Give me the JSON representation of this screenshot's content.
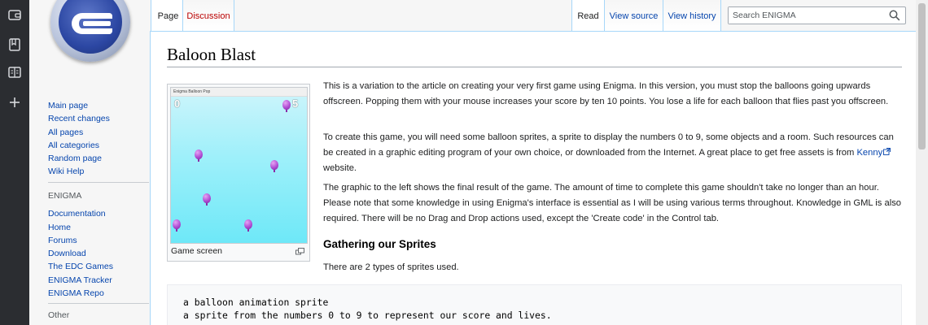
{
  "rail": {
    "icons": [
      "wallet-icon",
      "bookmark-icon",
      "reader-icon",
      "plus-icon"
    ]
  },
  "logo": {
    "name": "enigma-logo-icon"
  },
  "sidebar": {
    "navigation": [
      "Main page",
      "Recent changes",
      "All pages",
      "All categories",
      "Random page",
      "Wiki Help"
    ],
    "enigma_heading": "ENIGMA",
    "enigma_links": [
      "Documentation",
      "Home",
      "Forums",
      "Download",
      "The EDC Games",
      "ENIGMA Tracker",
      "ENIGMA Repo"
    ],
    "other_heading": "Other"
  },
  "tabs": {
    "page": "Page",
    "discussion": "Discussion",
    "read": "Read",
    "view_source": "View source",
    "view_history": "View history"
  },
  "search": {
    "placeholder": "Search ENIGMA",
    "icon": "search-icon"
  },
  "article": {
    "title": "Baloon Blast",
    "thumbnail": {
      "window_title": "Enigma Balloon Pop",
      "score": "0",
      "lives": "5",
      "caption": "Game screen",
      "enlarge_icon": "enlarge-icon"
    },
    "para1": "This is a variation to the article on creating your very first game using Enigma. In this version, you must stop the balloons going upwards offscreen. Popping them with your mouse increases your score by ten 10 points. You lose a life for each balloon that flies past you offscreen.",
    "para2_before": "To create this game, you will need some balloon sprites, a sprite to display the numbers 0 to 9, some objects and a room. Such resources can be created in a graphic editing program of your own choice, or downloaded from the Internet. A great place to get free assets is from ",
    "para2_link": "Kenny",
    "para2_after": " website.",
    "para3": "The graphic to the left shows the final result of the game. The amount of time to complete this game shouldn't take no longer than an hour. Please note that some knowledge in using Enigma's interface is essential as I will be using various terms throughout. Knowledge in GML is also required. There will be no Drag and Drop actions used, except the 'Create code' in the Control tab.",
    "section_heading": "Gathering our Sprites",
    "para4": "There are 2 types of sprites used.",
    "code_lines": [
      "a balloon animation sprite",
      "a sprite from the numbers 0 to 9 to represent our score and lives."
    ]
  }
}
